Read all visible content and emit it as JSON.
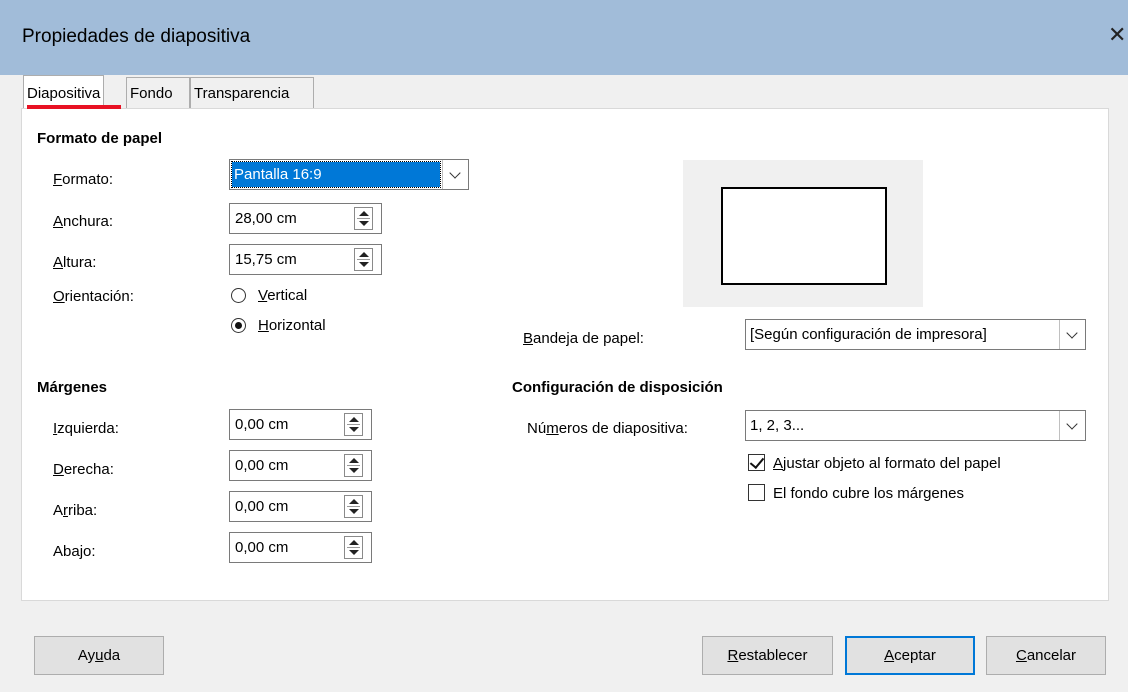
{
  "window": {
    "title": "Propiedades de diapositiva",
    "close_glyph": "✕"
  },
  "tabs": [
    {
      "label": "Diapositiva",
      "active": true
    },
    {
      "label": "Fondo",
      "active": false
    },
    {
      "label": "Transparencia",
      "active": false
    }
  ],
  "accent_color": "#e81123",
  "paper_format": {
    "section_title": "Formato de papel",
    "format": {
      "label_first": "F",
      "label_rest": "ormato:",
      "value": "Pantalla 16:9"
    },
    "width": {
      "label_first": "A",
      "label_rest": "nchura:",
      "value": "28,00 cm"
    },
    "height": {
      "label_first": "A",
      "label_rest": "ltura:",
      "value": "15,75 cm"
    },
    "orientation": {
      "label_first": "O",
      "label_rest": "rientación:",
      "options": [
        {
          "first": "V",
          "rest": "ertical",
          "selected": false
        },
        {
          "first": "H",
          "rest": "orizontal",
          "selected": true
        }
      ]
    }
  },
  "paper_tray": {
    "label_first": "B",
    "label_rest": "andeja de papel:",
    "value": "[Según configuración de impresora]"
  },
  "margins": {
    "section_title": "Márgenes",
    "left": {
      "label_first": "I",
      "label_rest": "zquierda:",
      "value": "0,00 cm"
    },
    "right": {
      "label_first": "D",
      "label_rest": "erecha:",
      "value": "0,00 cm"
    },
    "top": {
      "label_pre": "A",
      "label_ul": "r",
      "label_post": "riba:",
      "value": "0,00 cm"
    },
    "bottom": {
      "label_pre": "Aba",
      "label_ul": "j",
      "label_post": "o:",
      "value": "0,00 cm"
    }
  },
  "layout_settings": {
    "section_title": "Configuración de disposición",
    "slide_numbers": {
      "label_pre": "Nú",
      "label_ul": "m",
      "label_post": "eros de diapositiva:",
      "value": "1, 2, 3..."
    },
    "fit_object": {
      "first": "A",
      "rest": "justar objeto al formato del papel",
      "checked": true
    },
    "bg_covers_margins": {
      "label": "El fondo cubre los márgenes",
      "checked": false
    }
  },
  "buttons": {
    "help": {
      "pre": "Ay",
      "ul": "u",
      "post": "da"
    },
    "reset": {
      "pre": "",
      "ul": "R",
      "post": "establecer"
    },
    "ok": {
      "pre": "",
      "ul": "A",
      "post": "ceptar"
    },
    "cancel": {
      "pre": "",
      "ul": "C",
      "post": "ancelar"
    }
  }
}
